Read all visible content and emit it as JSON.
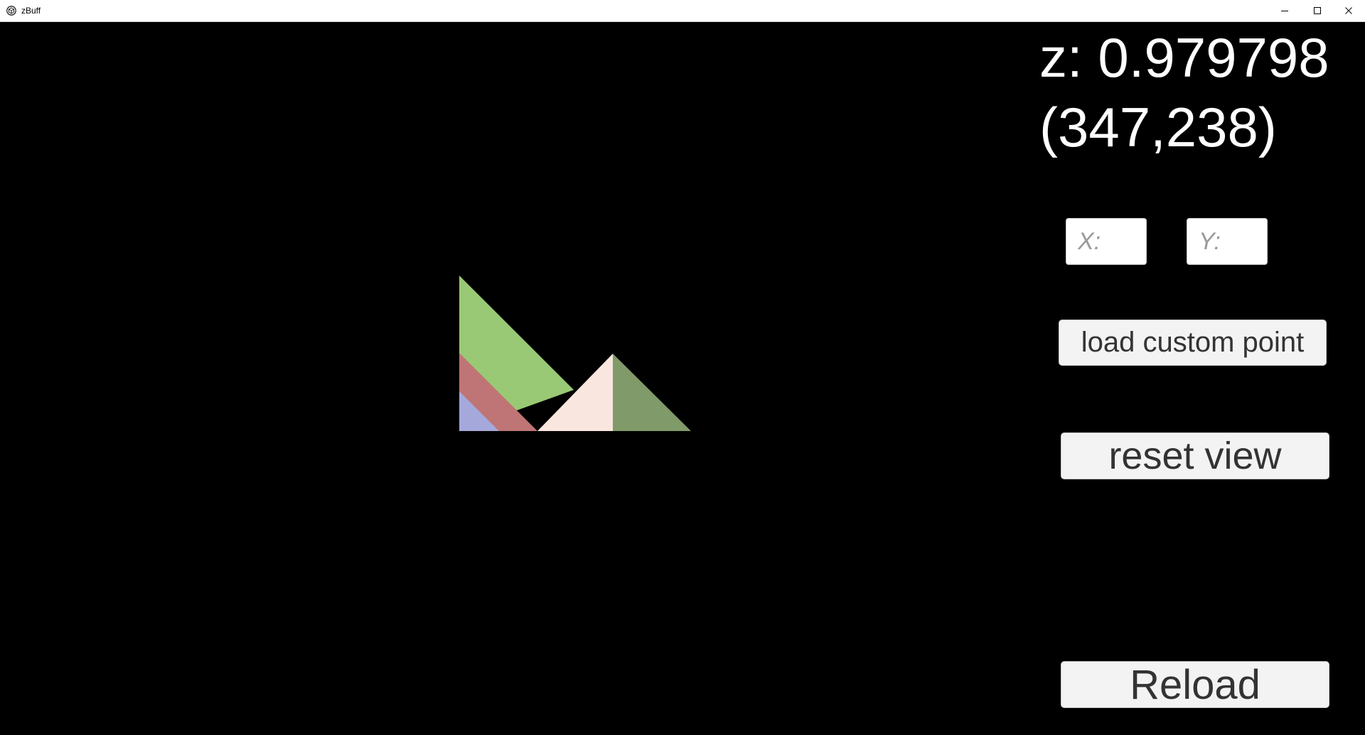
{
  "window": {
    "title": "zBuff",
    "icon": "unity-logo-icon",
    "controls": [
      "minimize-icon",
      "maximize-icon",
      "close-icon"
    ]
  },
  "readout": {
    "z_text": "z: 0.979798",
    "coord_text": "(347,238)"
  },
  "inputs": {
    "x_placeholder": "X:",
    "y_placeholder": "Y:"
  },
  "buttons": {
    "load_custom_point": "load custom point",
    "reset_view": "reset view",
    "reload": "Reload"
  },
  "scene": {
    "triangles": [
      {
        "name": "green-triangle",
        "color": "#9ac975"
      },
      {
        "name": "red-triangle",
        "color": "#bf7575"
      },
      {
        "name": "blue-triangle",
        "color": "#a4a8db"
      },
      {
        "name": "cream-triangle",
        "color": "#f9e7df"
      },
      {
        "name": "olive-triangle",
        "color": "#809a69"
      }
    ]
  }
}
